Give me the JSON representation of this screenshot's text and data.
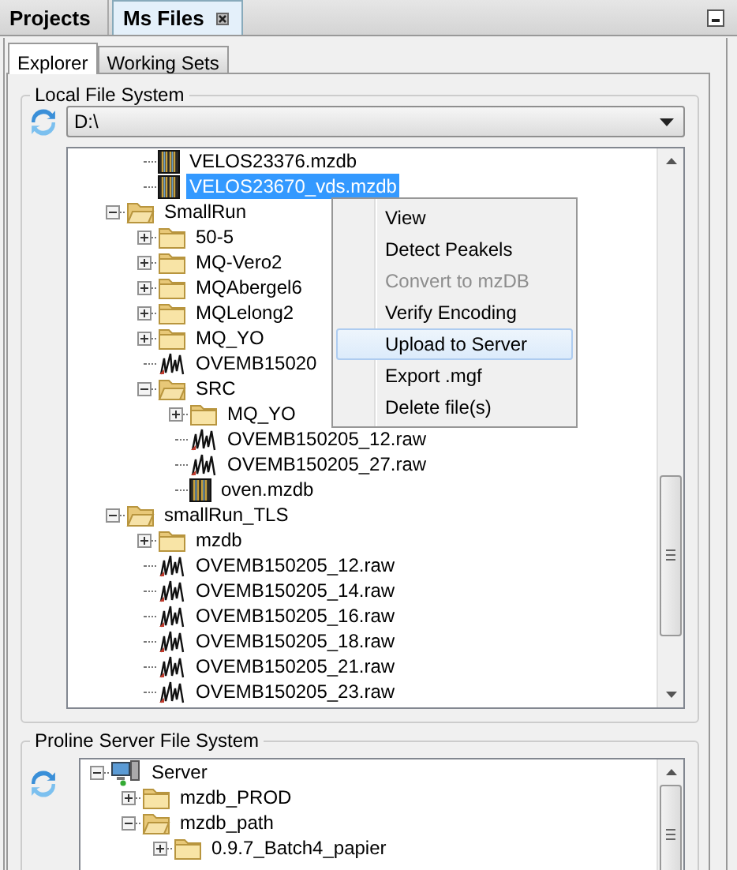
{
  "panel_tabs": [
    {
      "label": "Projects",
      "selected": false
    },
    {
      "label": "Ms Files",
      "selected": true,
      "closable": true
    }
  ],
  "sub_tabs": [
    {
      "label": "Explorer",
      "selected": true
    },
    {
      "label": "Working Sets",
      "selected": false
    }
  ],
  "local_file_system": {
    "title": "Local File System",
    "drive": "D:\\",
    "tree": [
      {
        "children": [
          {
            "label": "VELOS23376.mzdb",
            "kind": "mzdb",
            "selected": false
          },
          {
            "label": "VELOS23670_vds.mzdb",
            "kind": "mzdb",
            "selected": true
          }
        ]
      },
      {
        "label": "SmallRun",
        "kind": "folder",
        "expanded": true,
        "selected": false,
        "children": [
          {
            "label": "50-5",
            "kind": "folder",
            "expanded": false,
            "selected": false
          },
          {
            "label": "MQ-Vero2",
            "kind": "folder",
            "expanded": false,
            "selected": false
          },
          {
            "label": "MQAbergel6",
            "kind": "folder",
            "expanded": false,
            "selected": false
          },
          {
            "label": "MQLelong2",
            "kind": "folder",
            "expanded": false,
            "selected": false
          },
          {
            "label": "MQ_YO",
            "kind": "folder",
            "expanded": false,
            "selected": false
          },
          {
            "label": "OVEMB15020",
            "kind": "raw",
            "selected": false
          },
          {
            "label": "SRC",
            "kind": "folder",
            "expanded": true,
            "selected": false,
            "children": [
              {
                "label": "MQ_YO",
                "kind": "folder",
                "expanded": false,
                "selected": false
              },
              {
                "label": "OVEMB150205_12.raw",
                "kind": "raw",
                "selected": false
              },
              {
                "label": "OVEMB150205_27.raw",
                "kind": "raw",
                "selected": false
              },
              {
                "label": "oven.mzdb",
                "kind": "mzdb",
                "selected": false
              }
            ]
          }
        ]
      },
      {
        "label": "smallRun_TLS",
        "kind": "folder",
        "expanded": true,
        "selected": false,
        "children": [
          {
            "label": "mzdb",
            "kind": "folder",
            "expanded": false,
            "selected": false
          },
          {
            "label": "OVEMB150205_12.raw",
            "kind": "raw",
            "selected": false
          },
          {
            "label": "OVEMB150205_14.raw",
            "kind": "raw",
            "selected": false
          },
          {
            "label": "OVEMB150205_16.raw",
            "kind": "raw",
            "selected": false
          },
          {
            "label": "OVEMB150205_18.raw",
            "kind": "raw",
            "selected": false
          },
          {
            "label": "OVEMB150205_21.raw",
            "kind": "raw",
            "selected": false
          },
          {
            "label": "OVEMB150205_23.raw",
            "kind": "raw",
            "selected": false
          }
        ]
      }
    ]
  },
  "context_menu": {
    "items": [
      {
        "label": "View",
        "disabled": false,
        "selected": false
      },
      {
        "label": "Detect Peakels",
        "disabled": false,
        "selected": false
      },
      {
        "label": "Convert to mzDB",
        "disabled": true,
        "selected": false
      },
      {
        "label": "Verify Encoding",
        "disabled": false,
        "selected": false
      },
      {
        "label": "Upload to Server",
        "disabled": false,
        "selected": true
      },
      {
        "label": "Export .mgf",
        "disabled": false,
        "selected": false
      },
      {
        "label": "Delete file(s)",
        "disabled": false,
        "selected": false
      }
    ]
  },
  "server_file_system": {
    "title": "Proline Server File System",
    "tree": [
      {
        "label": "Server",
        "kind": "server",
        "expanded": true,
        "selected": false,
        "children": [
          {
            "label": "mzdb_PROD",
            "kind": "folder",
            "expanded": false,
            "selected": false
          },
          {
            "label": "mzdb_path",
            "kind": "folder",
            "expanded": true,
            "selected": false,
            "children": [
              {
                "label": "0.9.7_Batch4_papier",
                "kind": "folder",
                "expanded": false,
                "selected": false
              }
            ]
          }
        ]
      }
    ]
  }
}
